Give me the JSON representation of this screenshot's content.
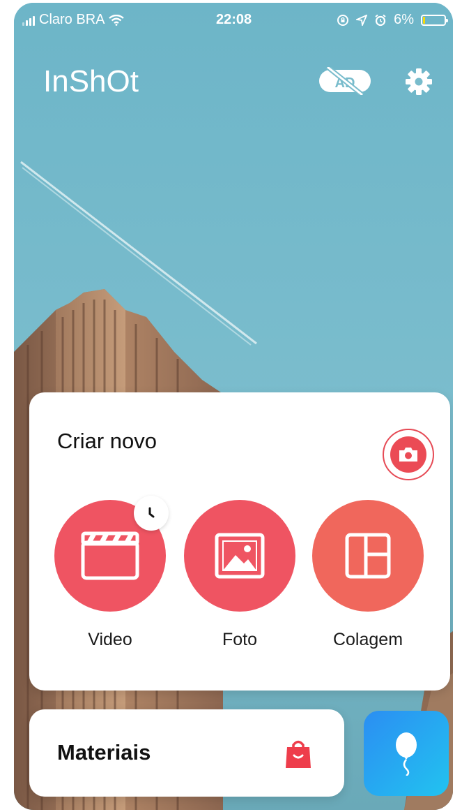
{
  "status_bar": {
    "carrier": "Claro BRA",
    "time": "22:08",
    "battery": "6%",
    "battery_level": 0.06
  },
  "app": {
    "logo": "InShOt"
  },
  "header": {
    "ad_icon_text": "AD",
    "ad_icon": "no-ads-icon",
    "settings_icon": "gear-icon"
  },
  "create": {
    "title": "Criar novo",
    "camera_icon": "camera-icon",
    "actions": [
      {
        "label": "Video",
        "icon": "clapperboard-icon",
        "color": "#ef5462"
      },
      {
        "label": "Foto",
        "icon": "image-icon",
        "color": "#ef5462"
      },
      {
        "label": "Colagem",
        "icon": "collage-icon",
        "color": "#f0675c"
      }
    ],
    "draft_badge_icon": "clock-icon"
  },
  "materials": {
    "label": "Materiais",
    "icon": "shopping-bag-icon"
  },
  "floating_button": {
    "icon": "balloon-icon"
  },
  "colors": {
    "accent": "#ef5462",
    "sky": "#79bccc",
    "float_gradient_start": "#2b8ef2",
    "float_gradient_end": "#22c3f0"
  }
}
